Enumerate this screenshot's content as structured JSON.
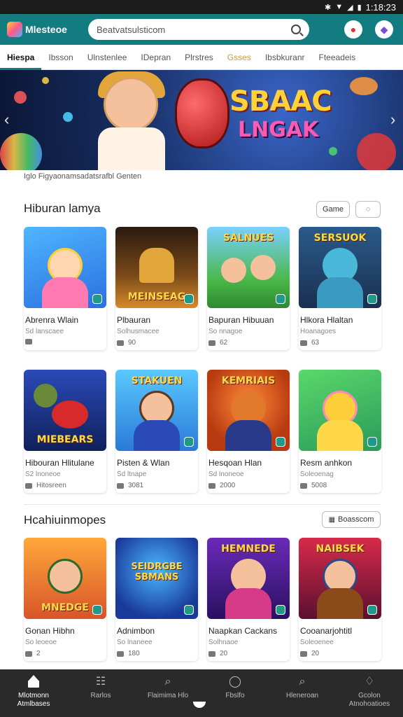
{
  "status": {
    "time": "1:18:23",
    "icons": [
      "bluetooth-icon",
      "wifi-icon",
      "signal-icon",
      "battery-icon"
    ]
  },
  "header": {
    "app_name": "Mlesteoe",
    "search_value": "Beatvatsulsticom",
    "accent": "#137c80"
  },
  "tabs": [
    {
      "label": "Hiespa",
      "active": true
    },
    {
      "label": "Ibsson"
    },
    {
      "label": "Ulnstenlee"
    },
    {
      "label": "IDepran"
    },
    {
      "label": "Plrstres"
    },
    {
      "label": "Gsses",
      "highlight": true
    },
    {
      "label": "Ibsbkuranr"
    },
    {
      "label": "Fteeadeis"
    }
  ],
  "hero": {
    "title": "SBAAC",
    "subtitle": "LNGAK",
    "caption": "Iglo Figyaonamsadatsrafbl Genten"
  },
  "section1": {
    "title": "Hiburan lamya",
    "filter_label": "Game",
    "cards": [
      {
        "art": "AMBER",
        "name": "Abrenra Wlain",
        "sub": "Sd lanscaee",
        "meta": ""
      },
      {
        "art": "MEINSEAG",
        "name": "Plbauran",
        "sub": "Solhusmacee",
        "meta": "90"
      },
      {
        "art": "SALNUES",
        "name": "Bapuran Hibuuan",
        "sub": "So nnagoe",
        "meta": "62"
      },
      {
        "art": "SERSUOK",
        "name": "Hlkora Hlaltan",
        "sub": "Hoanagoes",
        "meta": "63"
      },
      {
        "art": "MIEBEARS",
        "name": "Hibouran Hlitulane",
        "sub": "S2 lnoneoe",
        "meta": "Hitosreen"
      },
      {
        "art": "STAKUEN",
        "name": "Pisten & Wlan",
        "sub": "Sd ltnape",
        "meta": "3081"
      },
      {
        "art": "KEMRIAIS",
        "name": "Hesqoan Hlan",
        "sub": "Sd lnoneoe",
        "meta": "2000"
      },
      {
        "art": "",
        "name": "Resm anhkon",
        "sub": "Soleoenag",
        "meta": "5008"
      }
    ]
  },
  "section2": {
    "title": "Hcahiuinmopes",
    "button_label": "Boasscom",
    "cards": [
      {
        "art": "MNEDGE",
        "name": "Gonan Hibhn",
        "sub": "So leoeoe",
        "meta": "2"
      },
      {
        "art": "SEIDRGBE SBMANS",
        "name": "Adnimbon",
        "sub": "So lnaneee",
        "meta": "180"
      },
      {
        "art": "HEMNEDE",
        "name": "Naapkan Cackans",
        "sub": "Solhnaoe",
        "meta": "20"
      },
      {
        "art": "NAIBSEK",
        "name": "Cooanarjohtitl",
        "sub": "Soleoenee",
        "meta": "20"
      }
    ]
  },
  "bottom_nav": [
    {
      "label": "Mlotmonn Atmlbases",
      "icon": "home-icon",
      "active": true
    },
    {
      "label": "Rarlos",
      "icon": "grid-icon"
    },
    {
      "label": "Flaimima Hlo",
      "icon": "search-icon"
    },
    {
      "label": "Fbslfo",
      "icon": "chat-icon"
    },
    {
      "label": "Hleneroan",
      "icon": "search-icon"
    },
    {
      "label": "Gcolon Atnohoatioes",
      "icon": "bell-icon"
    }
  ]
}
